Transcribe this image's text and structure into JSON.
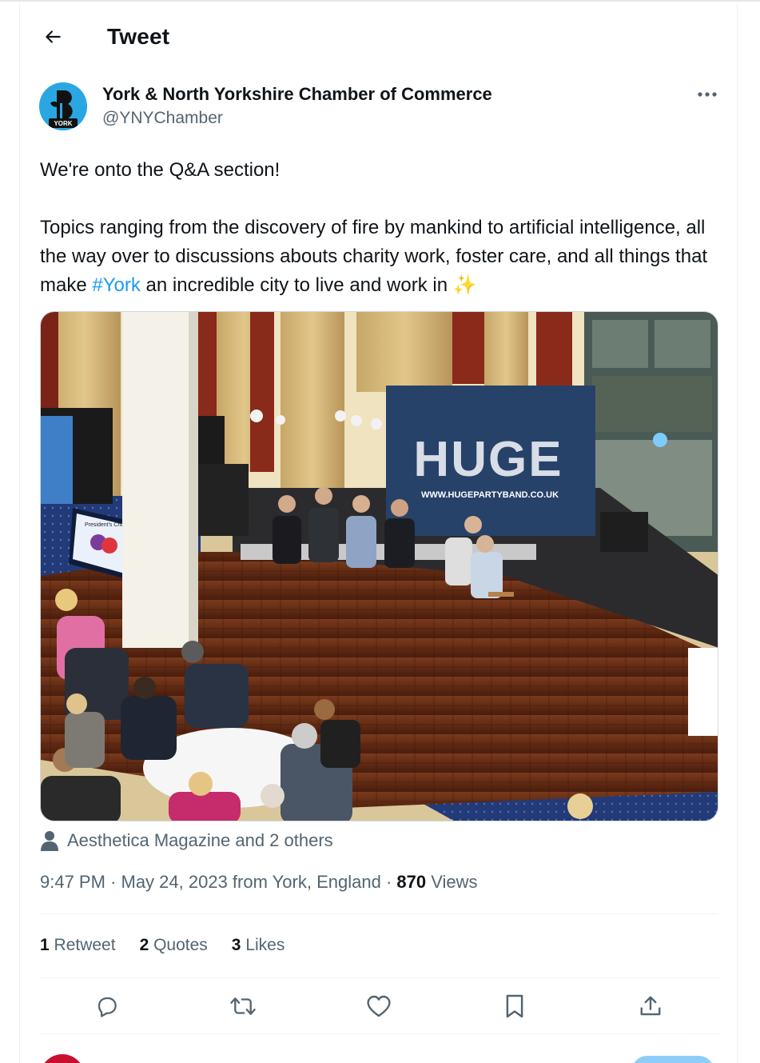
{
  "header": {
    "title": "Tweet"
  },
  "author": {
    "name": "York & North Yorkshire Chamber of Commerce",
    "handle": "@YNYChamber",
    "avatar_text": "YORK",
    "avatar_color": "#2aa7e3"
  },
  "tweet": {
    "line1": "We're onto the Q&A section!",
    "para2_before": "Topics ranging from the discovery of fire by mankind to artificial intelligence, all the way over to discussions abouts charity work, foster care, and all things that make ",
    "hashtag": "#York",
    "para2_after": " an incredible city to live and work in ",
    "emoji": "✨"
  },
  "media": {
    "banner_text": "HUGE",
    "banner_url": "WWW.HUGEPARTYBAND.CO.UK",
    "screen_text": "President's Charity"
  },
  "tagged": {
    "text": "Aesthetica Magazine and 2 others"
  },
  "meta": {
    "time": "9:47 PM",
    "sep1": " · ",
    "date": "May 24, 2023",
    "from": " from York, England",
    "sep2": " · ",
    "views_count": "870",
    "views_label": " Views"
  },
  "stats": [
    {
      "count": "1",
      "label": " Retweet"
    },
    {
      "count": "2",
      "label": " Quotes"
    },
    {
      "count": "3",
      "label": " Likes"
    }
  ],
  "icons": {
    "back": "arrow-left-icon",
    "more": "ellipsis-icon",
    "tagged": "person-icon",
    "reply": "reply-icon",
    "retweet": "retweet-icon",
    "like": "heart-icon",
    "bookmark": "bookmark-icon",
    "share": "share-icon"
  },
  "colors": {
    "accent": "#1d9bf0",
    "text": "#0f1419",
    "secondary": "#536471"
  }
}
